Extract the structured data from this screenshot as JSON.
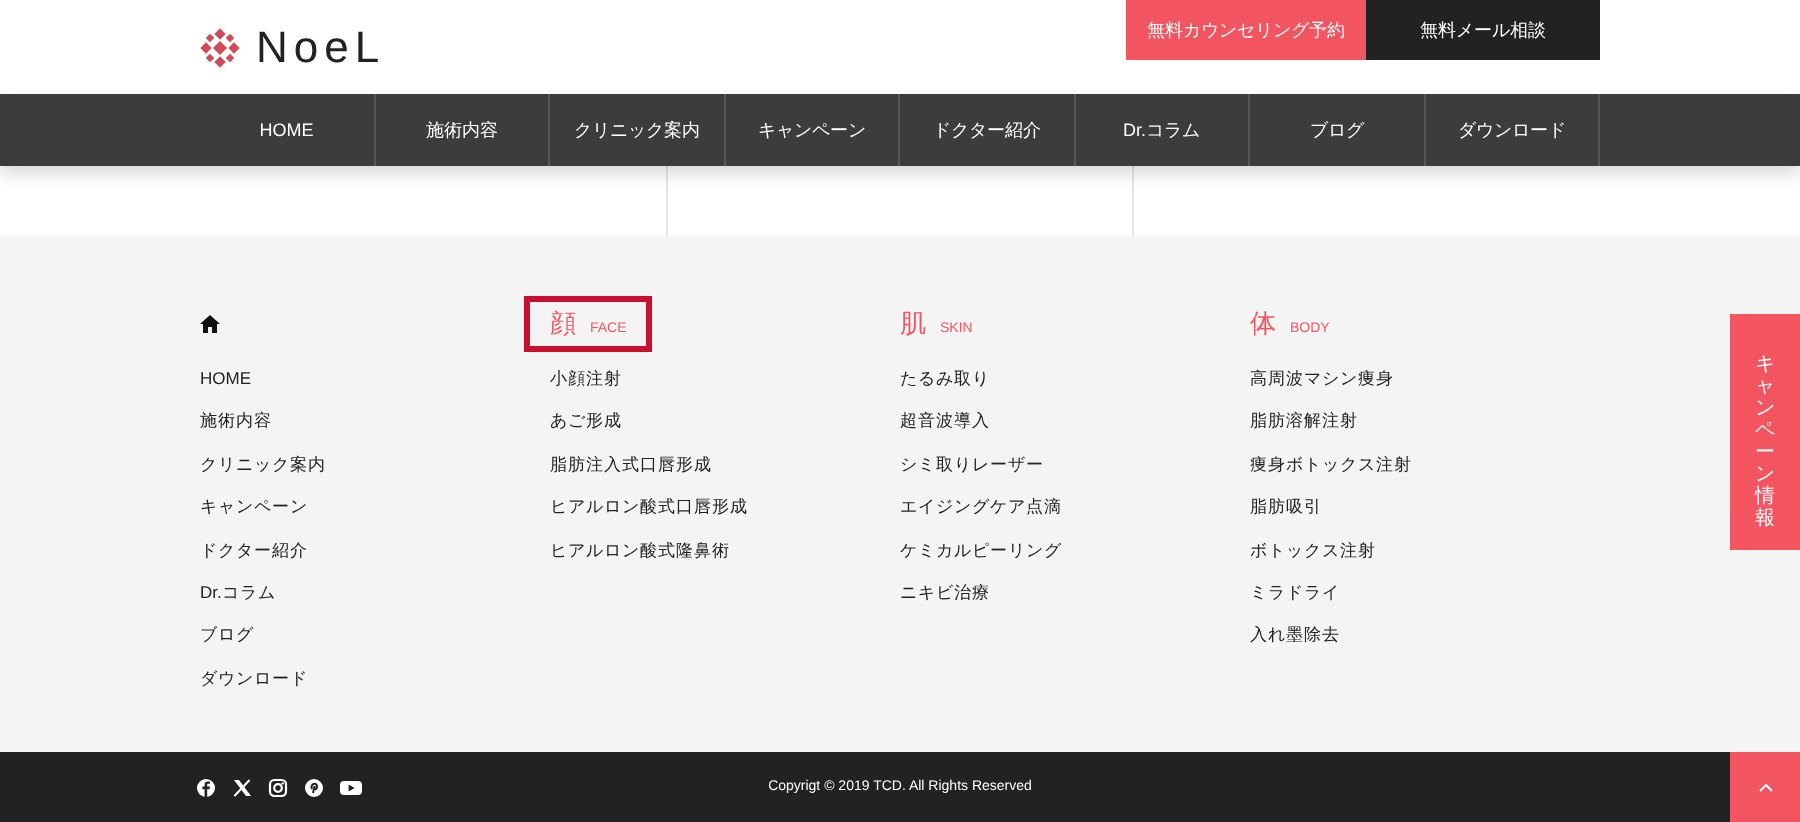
{
  "header": {
    "logo": "NoeL",
    "buttons": [
      {
        "label": "無料カウンセリング予約",
        "kind": "primary"
      },
      {
        "label": "無料メール相談",
        "kind": "dark"
      }
    ]
  },
  "nav": {
    "items": [
      "HOME",
      "施術内容",
      "クリニック案内",
      "キャンペーン",
      "ドクター紹介",
      "Dr.コラム",
      "ブログ",
      "ダウンロード"
    ]
  },
  "footer_menu": {
    "columns": [
      {
        "kind": "home",
        "highlighted": false,
        "items": [
          "HOME",
          "施術内容",
          "クリニック案内",
          "キャンペーン",
          "ドクター紹介",
          "Dr.コラム",
          "ブログ",
          "ダウンロード"
        ]
      },
      {
        "kind": "category",
        "title": "顔",
        "subtitle": "FACE",
        "highlighted": true,
        "items": [
          "小顔注射",
          "あご形成",
          "脂肪注入式口唇形成",
          "ヒアルロン酸式口唇形成",
          "ヒアルロン酸式隆鼻術"
        ]
      },
      {
        "kind": "category",
        "title": "肌",
        "subtitle": "SKIN",
        "highlighted": false,
        "items": [
          "たるみ取り",
          "超音波導入",
          "シミ取りレーザー",
          "エイジングケア点滴",
          "ケミカルピーリング",
          "ニキビ治療"
        ]
      },
      {
        "kind": "category",
        "title": "体",
        "subtitle": "BODY",
        "highlighted": false,
        "items": [
          "高周波マシン痩身",
          "脂肪溶解注射",
          "痩身ボトックス注射",
          "脂肪吸引",
          "ボトックス注射",
          "ミラドライ",
          "入れ墨除去"
        ]
      }
    ]
  },
  "side_tab": {
    "label": "キャンペーン情報"
  },
  "bottom_bar": {
    "copyright": "Copyrigt © 2019 TCD. All Rights Reserved"
  }
}
